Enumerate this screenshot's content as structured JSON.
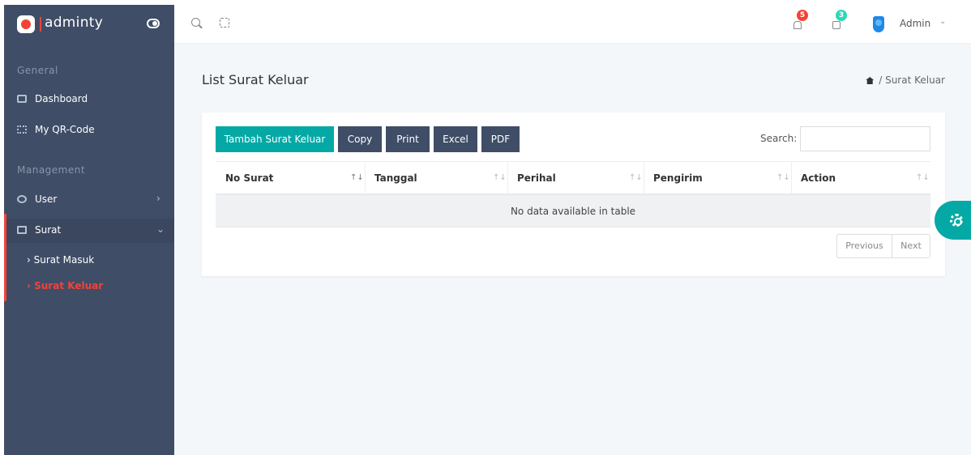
{
  "brand": {
    "name": "adminty"
  },
  "sidebar": {
    "captions": [
      "General",
      "Management"
    ],
    "items": [
      {
        "label": "Dashboard",
        "icon": "dashboard-icon"
      },
      {
        "label": "My QR-Code",
        "icon": "qrcode-icon"
      },
      {
        "label": "User",
        "icon": "users-icon",
        "chevron": "›"
      },
      {
        "label": "Surat",
        "icon": "document-icon",
        "chevron": "⌄"
      }
    ],
    "subitems": [
      {
        "label": "› Surat Masuk",
        "active": false
      },
      {
        "label": "› Surat Keluar",
        "active": true
      }
    ]
  },
  "topbar": {
    "notifications_count": "5",
    "messages_count": "3",
    "user_name": "Admin",
    "user_caret": "⌄"
  },
  "page": {
    "title": "List Surat Keluar",
    "breadcrumb": "/ Surat Keluar"
  },
  "toolbar": {
    "add_label": "Tambah Surat Keluar",
    "copy_label": "Copy",
    "print_label": "Print",
    "excel_label": "Excel",
    "pdf_label": "PDF",
    "search_label": "Search:",
    "search_value": ""
  },
  "table": {
    "columns": [
      "No Surat",
      "Tanggal",
      "Perihal",
      "Pengirim",
      "Action"
    ],
    "sort_up": "↑↓",
    "empty_text": "No data available in table"
  },
  "pager": {
    "prev": "Previous",
    "next": "Next"
  },
  "colors": {
    "sidebar": "#3f4d67",
    "accent": "#04a9a5",
    "danger": "#f44236",
    "success": "#2ed8b6"
  }
}
